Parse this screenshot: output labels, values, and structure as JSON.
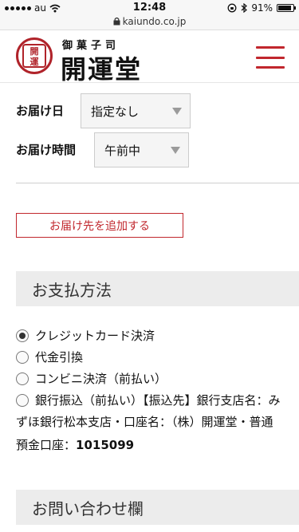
{
  "status_bar": {
    "carrier": "au",
    "time": "12:48",
    "battery": "91%",
    "battery_level": 0.91
  },
  "browser": {
    "url": "kaiundo.co.jp"
  },
  "header": {
    "logo_mark_text": "開運",
    "brand_sub": "御菓子司",
    "brand_name": "開運堂"
  },
  "delivery": {
    "date_label": "お届け日",
    "date_value": "指定なし",
    "time_label": "お届け時間",
    "time_value": "午前中",
    "add_destination_label": "お届け先を追加する"
  },
  "payment": {
    "section_title": "お支払方法",
    "options": [
      {
        "label": "クレジットカード決済",
        "checked": true
      },
      {
        "label": "代金引換",
        "checked": false
      },
      {
        "label": "コンビニ決済（前払い）",
        "checked": false
      },
      {
        "label": "銀行振込（前払い）【振込先】銀行支店名：み",
        "checked": false
      }
    ],
    "bank_line_2": "ずほ銀行松本支店・口座名：（株）開運堂・普通",
    "bank_line_3_prefix": "預金口座：",
    "bank_line_3_number": "1015099"
  },
  "inquiry": {
    "section_title": "お問い合わせ欄"
  }
}
